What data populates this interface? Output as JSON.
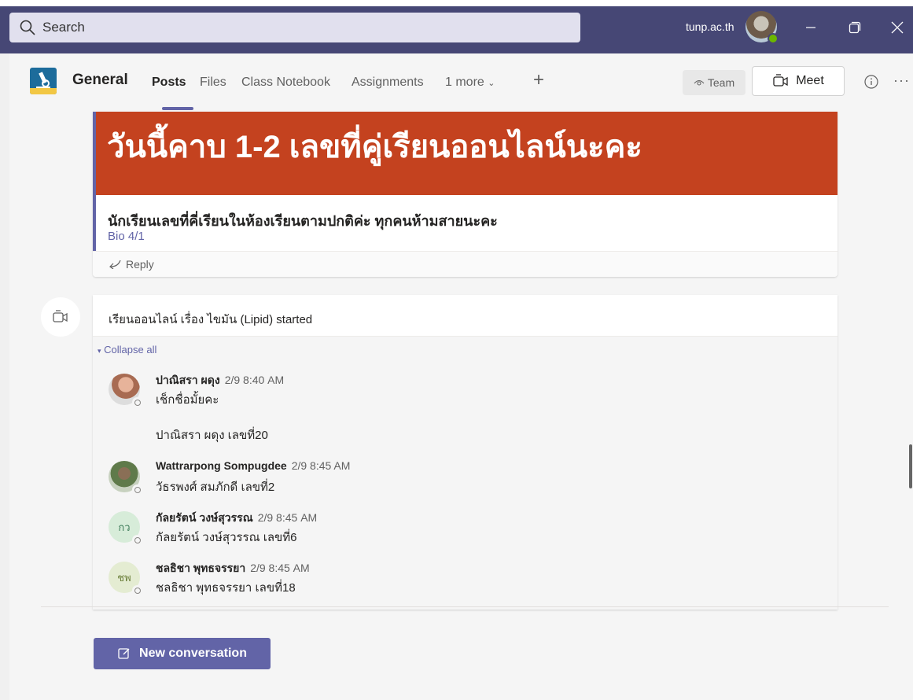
{
  "titlebar": {
    "search_placeholder": "Search",
    "org": "tunp.ac.th",
    "icons": [
      "search-icon",
      "minimize-icon",
      "maximize-icon",
      "close-icon"
    ]
  },
  "header": {
    "channel": "General",
    "tabs": [
      "Posts",
      "Files",
      "Class Notebook",
      "Assignments",
      "1 more"
    ],
    "active_tab": "Posts",
    "team_label": "Team",
    "meet_label": "Meet",
    "more_glyph": "···"
  },
  "announcement": {
    "banner": "วันนี้คาบ 1-2 เลขที่คู่เรียนออนไลน์นะคะ",
    "subtitle": "นักเรียนเลขที่คี่เรียนในห้องเรียนตามปกติค่ะ ทุกคนห้ามสายนะคะ",
    "class": "Bio 4/1",
    "reply": "Reply"
  },
  "meeting": {
    "title": "เรียนออนไลน์ เรื่อง ไขมัน (Lipid) started",
    "collapse": "Collapse all",
    "messages": [
      {
        "name": "ปาณิสรา ผดุง",
        "time": "2/9 8:40 AM",
        "lines": [
          "เช็กชื่อมั้ยคะ",
          "ปาณิสรา ผดุง เลขที่20"
        ]
      },
      {
        "name": "Wattrarpong Sompugdee",
        "time": "2/9 8:45 AM",
        "lines": [
          "วัธรพงศ์ สมภักดี เลขที่2"
        ]
      },
      {
        "name": "กัลยรัตน์ วงษ์สุวรรณ",
        "time": "2/9 8:45 AM",
        "initials": "กว",
        "lines": [
          "กัลยรัตน์ วงษ์สุวรรณ เลขที่6"
        ]
      },
      {
        "name": "ชลธิชา พุทธจรรยา",
        "time": "2/9 8:45 AM",
        "initials": "ชพ",
        "lines": [
          "ชลธิชา พุทธจรรยา เลขที่18"
        ]
      }
    ]
  },
  "new_conversation": "New conversation",
  "colors": {
    "brand": "#464775",
    "accent": "#6264a7",
    "banner": "#c4421f"
  }
}
